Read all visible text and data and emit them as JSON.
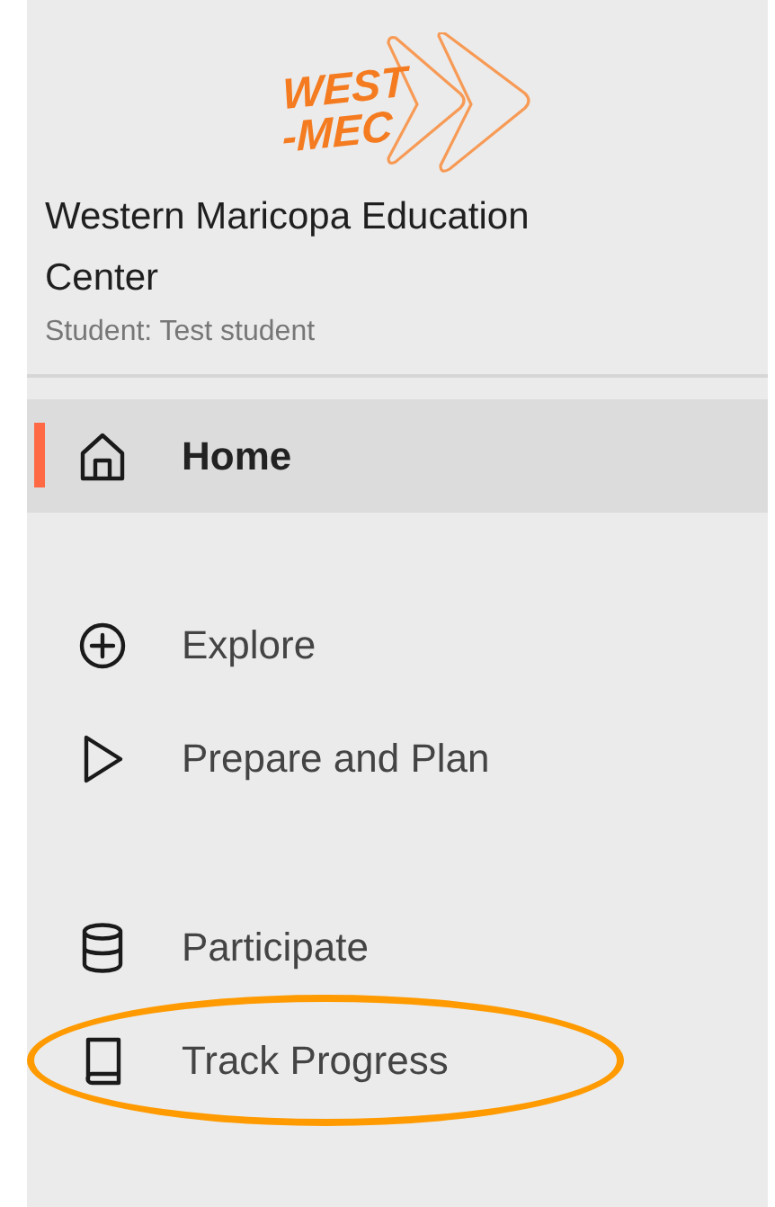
{
  "logo": {
    "lines": [
      "WEST",
      "-MEC"
    ]
  },
  "organization": {
    "name": "Western Maricopa Education Center",
    "student": "Student: Test student"
  },
  "nav_groups": [
    {
      "items": [
        {
          "label": "Home",
          "selected": true,
          "circled": false
        }
      ]
    },
    {
      "items": [
        {
          "label": "Explore",
          "selected": false,
          "circled": false
        },
        {
          "label": "Prepare and Plan",
          "selected": false,
          "circled": false
        }
      ]
    },
    {
      "items": [
        {
          "label": "Participate",
          "selected": false,
          "circled": false
        },
        {
          "label": "Track Progress",
          "selected": false,
          "circled": true
        }
      ]
    }
  ]
}
